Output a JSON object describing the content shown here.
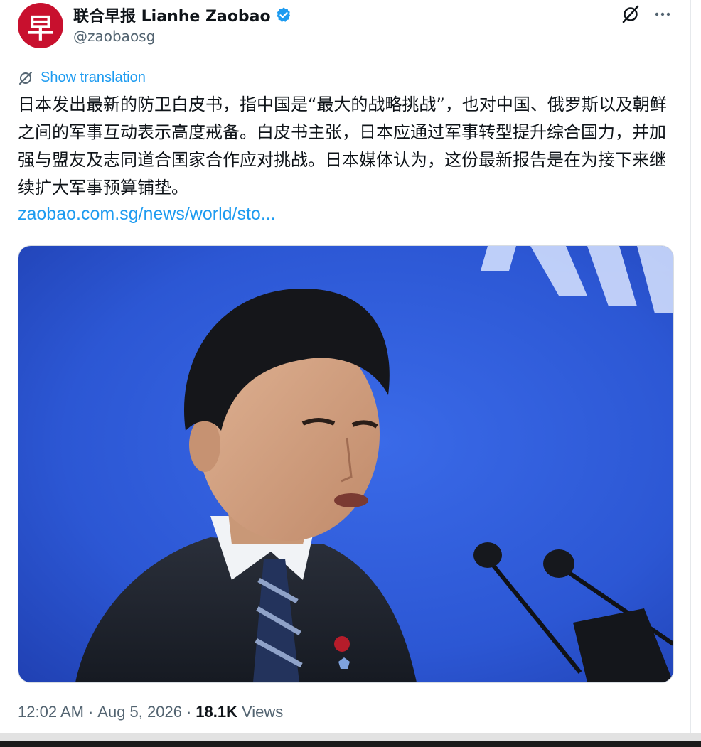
{
  "account": {
    "display_name": "联合早报 Lianhe Zaobao",
    "handle": "@zaobaosg",
    "avatar_glyph": "早",
    "avatar_color": "#c8102e",
    "verified": true,
    "verified_color": "#1d9bf0"
  },
  "actions": {
    "grok_icon": "grok-icon",
    "more_icon": "more-icon"
  },
  "tweet": {
    "translate_label": "Show translation",
    "text": "日本发出最新的防卫白皮书，指中国是“最大的战略挑战”，也对中国、俄罗斯以及朝鲜之间的军事互动表示高度戒备。白皮书主张，日本应通过军事转型提升综合国力，并加强与盟友及志同道合国家合作应对挑战。日本媒体认为，这份最新报告是在为接下来继续扩大军事预算铺垫。",
    "link": "zaobao.com.sg/news/world/sto..."
  },
  "meta": {
    "time": "12:02 AM",
    "separator": "·",
    "date": "Aug 5, 2026",
    "views_count": "18.1K",
    "views_label": "Views"
  },
  "colors": {
    "link": "#1d9bf0",
    "secondary_text": "#536471",
    "primary_text": "#0f1419",
    "media_background": "#2f59d6"
  }
}
